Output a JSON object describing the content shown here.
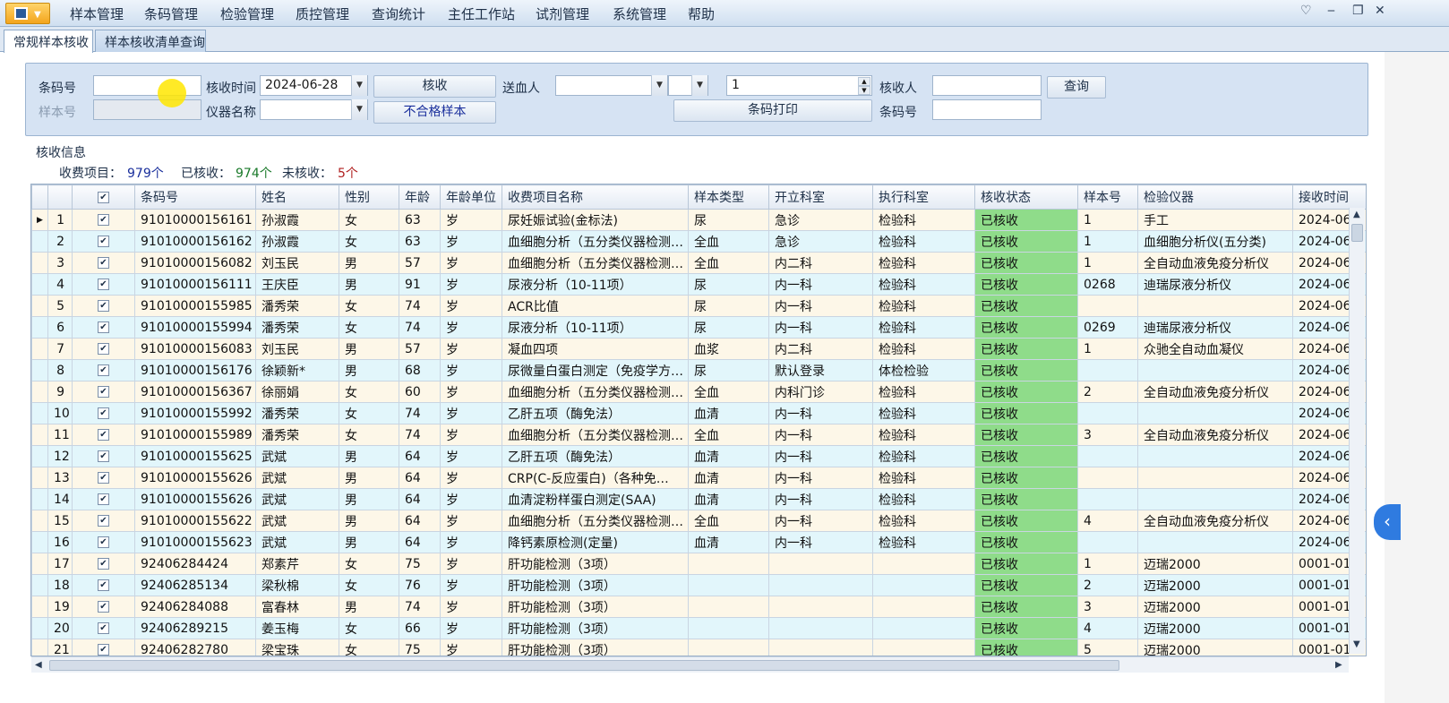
{
  "menubar": {
    "items": [
      "样本管理",
      "条码管理",
      "检验管理",
      "质控管理",
      "查询统计",
      "主任工作站",
      "试剂管理",
      "系统管理",
      "帮助"
    ]
  },
  "tabs": [
    "常规样本核收",
    "样本核收清单查询"
  ],
  "form": {
    "barcode_label": "条码号",
    "barcode_value": "",
    "recv_time_label": "核收时间",
    "recv_time_value": "2024-06-28",
    "verify_button": "核收",
    "sender_label": "送血人",
    "sender_value": "",
    "qty_value": "1",
    "receiver_label": "核收人",
    "receiver_value": "",
    "query_button": "查询",
    "sample_no_label": "样本号",
    "instrument_label": "仪器名称",
    "instrument_value": "",
    "unqualified_button": "不合格样本",
    "barcode_print_button": "条码打印",
    "barcode2_label": "条码号",
    "barcode2_value": ""
  },
  "summary": {
    "section_title": "核收信息",
    "fee_items_label": "收费项目：",
    "fee_items_value": "979个",
    "received_label": "已核收：",
    "received_value": "974个",
    "not_received_label": "未核收：",
    "not_received_value": "5个"
  },
  "colors": {
    "status_green": "#8fdc8a",
    "fee_items": "#1a2f9c",
    "received": "#1a7a2a",
    "not_received": "#b02020"
  },
  "grid": {
    "columns": [
      "",
      "",
      "条码号",
      "姓名",
      "性别",
      "年龄",
      "年龄单位",
      "收费项目名称",
      "样本类型",
      "开立科室",
      "执行科室",
      "核收状态",
      "样本号",
      "检验仪器",
      "接收时间"
    ],
    "rows": [
      [
        "1",
        "91010000156161",
        "孙淑霞",
        "女",
        "63",
        "岁",
        "尿妊娠试验(金标法)",
        "尿",
        "急诊",
        "检验科",
        "已核收",
        "1",
        "手工",
        "2024-06-"
      ],
      [
        "2",
        "91010000156162",
        "孙淑霞",
        "女",
        "63",
        "岁",
        "血细胞分析（五分类仪器检测…",
        "全血",
        "急诊",
        "检验科",
        "已核收",
        "1",
        "血细胞分析仪(五分类)",
        "2024-06-"
      ],
      [
        "3",
        "91010000156082",
        "刘玉民",
        "男",
        "57",
        "岁",
        "血细胞分析（五分类仪器检测…",
        "全血",
        "内二科",
        "检验科",
        "已核收",
        "1",
        "全自动血液免疫分析仪",
        "2024-06-"
      ],
      [
        "4",
        "91010000156111",
        "王庆臣",
        "男",
        "91",
        "岁",
        "尿液分析（10-11项）",
        "尿",
        "内一科",
        "检验科",
        "已核收",
        "0268",
        "迪瑞尿液分析仪",
        "2024-06-"
      ],
      [
        "5",
        "91010000155985",
        "潘秀荣",
        "女",
        "74",
        "岁",
        "ACR比值",
        "尿",
        "内一科",
        "检验科",
        "已核收",
        "",
        "",
        "2024-06-"
      ],
      [
        "6",
        "91010000155994",
        "潘秀荣",
        "女",
        "74",
        "岁",
        "尿液分析（10-11项）",
        "尿",
        "内一科",
        "检验科",
        "已核收",
        "0269",
        "迪瑞尿液分析仪",
        "2024-06-"
      ],
      [
        "7",
        "91010000156083",
        "刘玉民",
        "男",
        "57",
        "岁",
        "凝血四项",
        "血浆",
        "内二科",
        "检验科",
        "已核收",
        "1",
        "众驰全自动血凝仪",
        "2024-06-"
      ],
      [
        "8",
        "91010000156176",
        "徐颖新*",
        "男",
        "68",
        "岁",
        "尿微量白蛋白测定（免疫学方…",
        "尿",
        "默认登录",
        "体检检验",
        "已核收",
        "",
        "",
        "2024-06-"
      ],
      [
        "9",
        "91010000156367",
        "徐丽娟",
        "女",
        "60",
        "岁",
        "血细胞分析（五分类仪器检测…",
        "全血",
        "内科门诊",
        "检验科",
        "已核收",
        "2",
        "全自动血液免疫分析仪",
        "2024-06-"
      ],
      [
        "10",
        "91010000155992",
        "潘秀荣",
        "女",
        "74",
        "岁",
        "乙肝五项（酶免法）",
        "血清",
        "内一科",
        "检验科",
        "已核收",
        "",
        "",
        "2024-06-"
      ],
      [
        "11",
        "91010000155989",
        "潘秀荣",
        "女",
        "74",
        "岁",
        "血细胞分析（五分类仪器检测…",
        "全血",
        "内一科",
        "检验科",
        "已核收",
        "3",
        "全自动血液免疫分析仪",
        "2024-06-"
      ],
      [
        "12",
        "91010000155625",
        "武斌",
        "男",
        "64",
        "岁",
        "乙肝五项（酶免法）",
        "血清",
        "内一科",
        "检验科",
        "已核收",
        "",
        "",
        "2024-06-"
      ],
      [
        "13",
        "91010000155626",
        "武斌",
        "男",
        "64",
        "岁",
        "CRP(C-反应蛋白)（各种免…",
        "血清",
        "内一科",
        "检验科",
        "已核收",
        "",
        "",
        "2024-06-"
      ],
      [
        "14",
        "91010000155626",
        "武斌",
        "男",
        "64",
        "岁",
        "血清淀粉样蛋白测定(SAA)",
        "血清",
        "内一科",
        "检验科",
        "已核收",
        "",
        "",
        "2024-06-"
      ],
      [
        "15",
        "91010000155622",
        "武斌",
        "男",
        "64",
        "岁",
        "血细胞分析（五分类仪器检测…",
        "全血",
        "内一科",
        "检验科",
        "已核收",
        "4",
        "全自动血液免疫分析仪",
        "2024-06-"
      ],
      [
        "16",
        "91010000155623",
        "武斌",
        "男",
        "64",
        "岁",
        "降钙素原检测(定量)",
        "血清",
        "内一科",
        "检验科",
        "已核收",
        "",
        "",
        "2024-06-"
      ],
      [
        "17",
        "92406284424",
        "郑素芹",
        "女",
        "75",
        "岁",
        "肝功能检测（3项）",
        "",
        "",
        "",
        "已核收",
        "1",
        "迈瑞2000",
        "0001-01-"
      ],
      [
        "18",
        "92406285134",
        "梁秋棉",
        "女",
        "76",
        "岁",
        "肝功能检测（3项）",
        "",
        "",
        "",
        "已核收",
        "2",
        "迈瑞2000",
        "0001-01-"
      ],
      [
        "19",
        "92406284088",
        "富春林",
        "男",
        "74",
        "岁",
        "肝功能检测（3项）",
        "",
        "",
        "",
        "已核收",
        "3",
        "迈瑞2000",
        "0001-01-"
      ],
      [
        "20",
        "92406289215",
        "姜玉梅",
        "女",
        "66",
        "岁",
        "肝功能检测（3项）",
        "",
        "",
        "",
        "已核收",
        "4",
        "迈瑞2000",
        "0001-01-"
      ],
      [
        "21",
        "92406282780",
        "梁宝珠",
        "女",
        "75",
        "岁",
        "肝功能检测（3项）",
        "",
        "",
        "",
        "已核收",
        "5",
        "迈瑞2000",
        "0001-01-"
      ]
    ]
  }
}
